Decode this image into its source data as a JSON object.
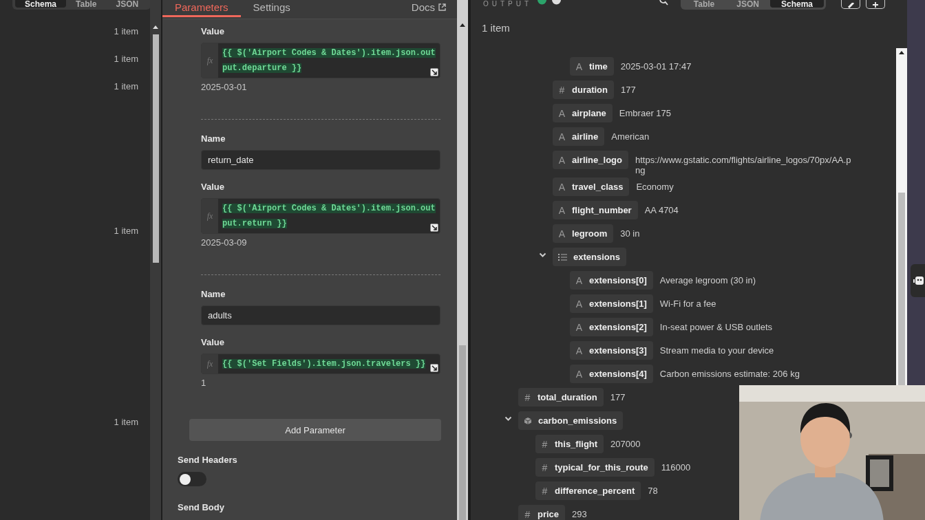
{
  "input_panel": {
    "view_tabs": [
      {
        "label": "Schema",
        "selected": true
      },
      {
        "label": "Table",
        "selected": false
      },
      {
        "label": "JSON",
        "selected": false
      }
    ],
    "item_counts": [
      "1 item",
      "1 item",
      "1 item",
      "1 item",
      "1 item"
    ]
  },
  "node_panel": {
    "tabs": [
      {
        "label": "Parameters",
        "selected": true
      },
      {
        "label": "Settings",
        "selected": false
      }
    ],
    "docs_link": "Docs",
    "parameters": [
      {
        "value_label": "Value",
        "mode_icon": "fx",
        "expression": "{{ $('Airport Codes & Dates').item.json.output.departure }}",
        "result": "2025-03-01"
      },
      {
        "name_label": "Name",
        "name": "return_date",
        "value_label": "Value",
        "mode_icon": "fx",
        "expression": "{{ $('Airport Codes & Dates').item.json.output.return }}",
        "result": "2025-03-09"
      },
      {
        "name_label": "Name",
        "name": "adults",
        "value_label": "Value",
        "mode_icon": "fx",
        "expression": "{{ $('Set Fields').item.json.travelers }}",
        "result": "1"
      }
    ],
    "add_button": "Add Parameter",
    "send_headers": {
      "label": "Send Headers",
      "on": false
    },
    "send_body": {
      "label": "Send Body"
    }
  },
  "output_panel": {
    "title": "OUTPUT",
    "view_tabs": [
      {
        "label": "Table",
        "selected": false
      },
      {
        "label": "JSON",
        "selected": false
      },
      {
        "label": "Schema",
        "selected": true
      }
    ],
    "item_count": "1 item",
    "tree": [
      {
        "kind": "group",
        "children": [
          {
            "kind": "group",
            "children": [
              {
                "kind": "group",
                "children": [
                  {
                    "kind": "field",
                    "icon": "A",
                    "key": "time",
                    "value": "2025-03-01 17:47"
                  }
                ]
              },
              {
                "kind": "field",
                "icon": "#",
                "key": "duration",
                "value": "177"
              },
              {
                "kind": "field",
                "icon": "A",
                "key": "airplane",
                "value": "Embraer 175"
              },
              {
                "kind": "field",
                "icon": "A",
                "key": "airline",
                "value": "American"
              },
              {
                "kind": "field",
                "icon": "A",
                "key": "airline_logo",
                "value": "https://www.gstatic.com/flights/airline_logos/70px/AA.png"
              },
              {
                "kind": "field",
                "icon": "A",
                "key": "travel_class",
                "value": "Economy"
              },
              {
                "kind": "field",
                "icon": "A",
                "key": "flight_number",
                "value": "AA 4704"
              },
              {
                "kind": "field",
                "icon": "A",
                "key": "legroom",
                "value": "30 in"
              },
              {
                "kind": "array",
                "key": "extensions",
                "expanded": true,
                "children": [
                  {
                    "kind": "field",
                    "icon": "A",
                    "key": "extensions[0]",
                    "value": "Average legroom (30 in)"
                  },
                  {
                    "kind": "field",
                    "icon": "A",
                    "key": "extensions[1]",
                    "value": "Wi-Fi for a fee"
                  },
                  {
                    "kind": "field",
                    "icon": "A",
                    "key": "extensions[2]",
                    "value": "In-seat power & USB outlets"
                  },
                  {
                    "kind": "field",
                    "icon": "A",
                    "key": "extensions[3]",
                    "value": "Stream media to your device"
                  },
                  {
                    "kind": "field",
                    "icon": "A",
                    "key": "extensions[4]",
                    "value": "Carbon emissions estimate: 206 kg"
                  }
                ]
              }
            ]
          }
        ]
      },
      {
        "kind": "field",
        "icon": "#",
        "key": "total_duration",
        "value": "177"
      },
      {
        "kind": "object",
        "key": "carbon_emissions",
        "expanded": true,
        "children": [
          {
            "kind": "field",
            "icon": "#",
            "key": "this_flight",
            "value": "207000"
          },
          {
            "kind": "field",
            "icon": "#",
            "key": "typical_for_this_route",
            "value": "116000"
          },
          {
            "kind": "field",
            "icon": "#",
            "key": "difference_percent",
            "value": "78"
          }
        ]
      },
      {
        "kind": "field",
        "icon": "#",
        "key": "price",
        "value": "293"
      }
    ]
  }
}
